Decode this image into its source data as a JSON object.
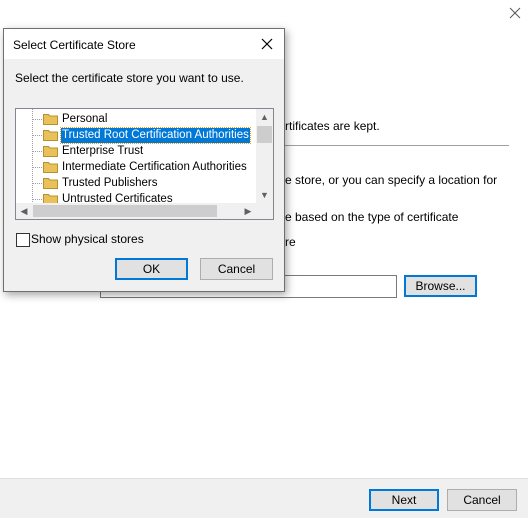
{
  "wizard": {
    "text_lines": [
      "rtificates are kept.",
      "e store, or you can specify a location for",
      "e based on the type of certificate",
      "re"
    ],
    "browse_label": "Browse...",
    "next_label": "Next",
    "cancel_label": "Cancel"
  },
  "dialog": {
    "title": "Select Certificate Store",
    "instruction": "Select the certificate store you want to use.",
    "stores": [
      {
        "label": "Personal",
        "selected": false
      },
      {
        "label": "Trusted Root Certification Authorities",
        "selected": true
      },
      {
        "label": "Enterprise Trust",
        "selected": false
      },
      {
        "label": "Intermediate Certification Authorities",
        "selected": false
      },
      {
        "label": "Trusted Publishers",
        "selected": false
      },
      {
        "label": "Untrusted Certificates",
        "selected": false
      }
    ],
    "show_physical_label": "Show physical stores",
    "show_physical_checked": false,
    "ok_label": "OK",
    "cancel_label": "Cancel"
  },
  "colors": {
    "selection": "#0078d7",
    "folder": "#e8c15a"
  }
}
